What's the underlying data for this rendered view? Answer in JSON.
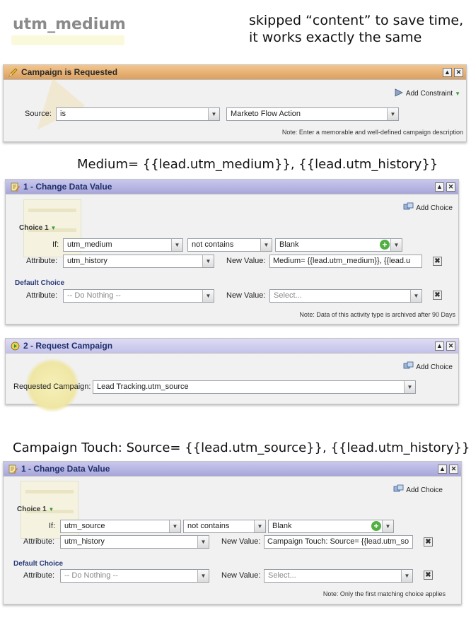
{
  "top": {
    "title": "utm_medium",
    "note_line1": "skipped “content” to save time,",
    "note_line2": "it works exactly the same"
  },
  "captions": {
    "medium": "Medium= {{lead.utm_medium}}, {{lead.utm_history}}",
    "touch": "Campaign Touch: Source= {{lead.utm_source}}, {{lead.utm_history}}"
  },
  "trigger": {
    "title": "Campaign is Requested",
    "add_constraint": "Add Constraint",
    "source_label": "Source:",
    "source_op": "is",
    "source_value": "Marketo Flow Action",
    "note": "Note: Enter a memorable and well-defined campaign description"
  },
  "flow1": {
    "title": "1 - Change Data Value",
    "add_choice": "Add Choice",
    "choice_label": "Choice 1",
    "if_label": "If:",
    "if_field": "utm_medium",
    "if_op": "not contains",
    "if_value": "Blank",
    "attr_label": "Attribute:",
    "attr_value": "utm_history",
    "new_value_label": "New Value:",
    "new_value": "Medium= {{lead.utm_medium}}, {{lead.u",
    "default_choice": "Default Choice",
    "def_attr_label": "Attribute:",
    "def_attr_value": "-- Do Nothing --",
    "def_new_value_label": "New Value:",
    "def_new_value": "Select...",
    "note": "Note: Data of this activity type is archived after 90 Days"
  },
  "flow2": {
    "title": "2 - Request Campaign",
    "add_choice": "Add Choice",
    "req_label": "Requested Campaign:",
    "req_value": "Lead Tracking.utm_source"
  },
  "flow3": {
    "title": "1 - Change Data Value",
    "add_choice": "Add Choice",
    "choice_label": "Choice 1",
    "if_label": "If:",
    "if_field": "utm_source",
    "if_op": "not contains",
    "if_value": "Blank",
    "attr_label": "Attribute:",
    "attr_value": "utm_history",
    "new_value_label": "New Value:",
    "new_value": "Campaign Touch: Source= {{lead.utm_so",
    "default_choice": "Default Choice",
    "def_attr_label": "Attribute:",
    "def_attr_value": "-- Do Nothing --",
    "def_new_value_label": "New Value:",
    "def_new_value": "Select...",
    "note": "Note: Only the first matching choice applies"
  },
  "glyphs": {
    "minimize": "▲",
    "close": "✕",
    "dropdown": "▼",
    "plus": "+",
    "remove": "✖"
  },
  "colors": {
    "trigger_header": "#dca060",
    "flow_header": "#a8a6da",
    "link_blue": "#2a3a7a"
  }
}
